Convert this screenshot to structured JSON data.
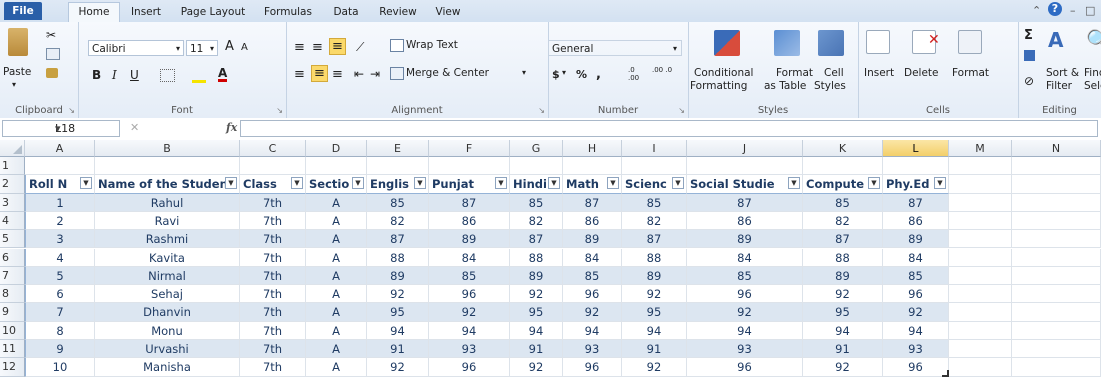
{
  "tabs": {
    "file": "File",
    "home": "Home",
    "insert": "Insert",
    "page_layout": "Page Layout",
    "formulas": "Formulas",
    "data": "Data",
    "review": "Review",
    "view": "View"
  },
  "ribbon": {
    "clipboard": {
      "label": "Clipboard",
      "paste": "Paste"
    },
    "font": {
      "label": "Font",
      "font_name": "Calibri",
      "font_size": "11",
      "bold": "B",
      "italic": "I",
      "underline": "U",
      "grow": "A",
      "shrink": "A",
      "font_color": "A"
    },
    "alignment": {
      "label": "Alignment",
      "wrap_text": "Wrap Text",
      "merge_center": "Merge & Center"
    },
    "number": {
      "label": "Number",
      "format": "General",
      "currency": "$",
      "percent": "%",
      "comma": ",",
      "inc_decimal": ".0 .00",
      "dec_decimal": ".00 .0"
    },
    "styles": {
      "label": "Styles",
      "conditional_1": "Conditional",
      "conditional_2": "Formatting",
      "format_table_1": "Format",
      "format_table_2": "as Table",
      "cell_styles_1": "Cell",
      "cell_styles_2": "Styles"
    },
    "cells": {
      "label": "Cells",
      "insert": "Insert",
      "delete": "Delete",
      "format": "Format"
    },
    "editing": {
      "label": "Editing",
      "sort_filter_1": "Sort &",
      "sort_filter_2": "Filter",
      "find_select_1": "Find &",
      "find_select_2": "Select"
    }
  },
  "formula_bar": {
    "name_box": "L18",
    "fx": "fx",
    "formula": ""
  },
  "columns": [
    "A",
    "B",
    "C",
    "D",
    "E",
    "F",
    "G",
    "H",
    "I",
    "J",
    "K",
    "L",
    "M",
    "N"
  ],
  "selected_column": "L",
  "rows": [
    "1",
    "2",
    "3",
    "4",
    "5",
    "6",
    "7",
    "8",
    "9",
    "10",
    "11",
    "12"
  ],
  "table": {
    "headers": [
      "Roll N",
      "Name of the Studen",
      "Class",
      "Sectio",
      "Englis",
      "Punjat",
      "Hindi",
      "Math",
      "Scienc",
      "Social Studie",
      "Compute",
      "Phy.Ed"
    ],
    "data": [
      [
        "1",
        "Rahul",
        "7th",
        "A",
        "85",
        "87",
        "85",
        "87",
        "85",
        "87",
        "85",
        "87"
      ],
      [
        "2",
        "Ravi",
        "7th",
        "A",
        "82",
        "86",
        "82",
        "86",
        "82",
        "86",
        "82",
        "86"
      ],
      [
        "3",
        "Rashmi",
        "7th",
        "A",
        "87",
        "89",
        "87",
        "89",
        "87",
        "89",
        "87",
        "89"
      ],
      [
        "4",
        "Kavita",
        "7th",
        "A",
        "88",
        "84",
        "88",
        "84",
        "88",
        "84",
        "88",
        "84"
      ],
      [
        "5",
        "Nirmal",
        "7th",
        "A",
        "89",
        "85",
        "89",
        "85",
        "89",
        "85",
        "89",
        "85"
      ],
      [
        "6",
        "Sehaj",
        "7th",
        "A",
        "92",
        "96",
        "92",
        "96",
        "92",
        "96",
        "92",
        "96"
      ],
      [
        "7",
        "Dhanvin",
        "7th",
        "A",
        "95",
        "92",
        "95",
        "92",
        "95",
        "92",
        "95",
        "92"
      ],
      [
        "8",
        "Monu",
        "7th",
        "A",
        "94",
        "94",
        "94",
        "94",
        "94",
        "94",
        "94",
        "94"
      ],
      [
        "9",
        "Urvashi",
        "7th",
        "A",
        "91",
        "93",
        "91",
        "93",
        "91",
        "93",
        "91",
        "93"
      ],
      [
        "10",
        "Manisha",
        "7th",
        "A",
        "92",
        "96",
        "92",
        "96",
        "92",
        "96",
        "92",
        "96"
      ]
    ]
  },
  "colors": {
    "band": "#dce6f1",
    "header_text": "#1f3b63",
    "selected_col": "#f3cf6a",
    "file_tab": "#2a5fa8"
  }
}
